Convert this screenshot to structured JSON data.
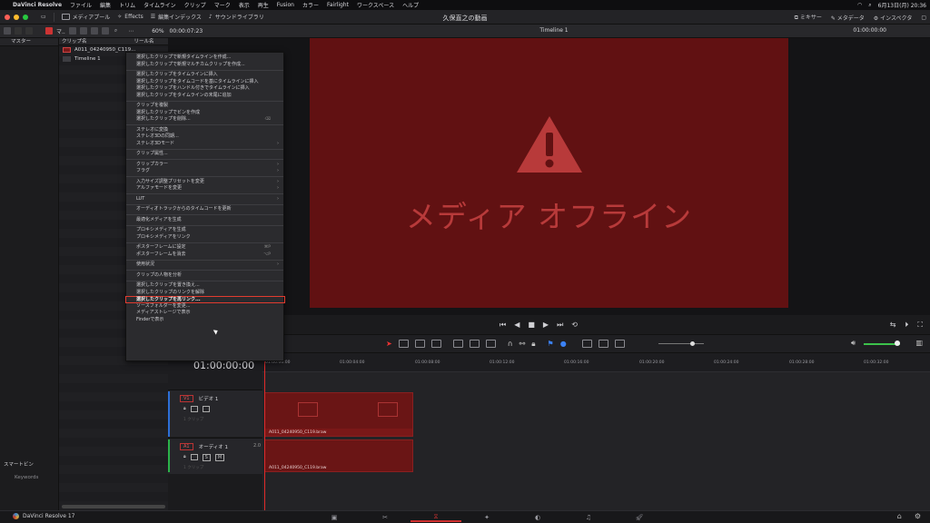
{
  "menubar": {
    "app": "DaVinci Resolve",
    "items": [
      "ファイル",
      "編集",
      "トリム",
      "タイムライン",
      "クリップ",
      "マーク",
      "表示",
      "再生",
      "Fusion",
      "カラー",
      "Fairlight",
      "ワークスペース",
      "ヘルプ"
    ],
    "clock": "6月13日(月)  20:36"
  },
  "topbar": {
    "media_pool": "メディアプール",
    "effects": "Effects",
    "edit_index": "編集インデックス",
    "sound_library": "サウンドライブラリ",
    "project_title": "久保直之の動画",
    "mixer": "ミキサー",
    "metadata": "メタデータ",
    "inspector": "インスペクタ"
  },
  "secbar": {
    "bin_label": "マ..",
    "zoom": "60%",
    "timecode": "00:00:07:23",
    "viewer_title": "Timeline 1",
    "viewer_tc": "01:00:00:00"
  },
  "sidebar": {
    "master": "マスター",
    "smart_bins": "スマートビン",
    "keywords": "Keywords"
  },
  "clip_list": {
    "header": "クリップ名",
    "header2": "リール名",
    "clips": [
      "A011_04240950_C119...",
      "Timeline 1"
    ]
  },
  "viewer": {
    "offline_text": "メディア オフライン"
  },
  "context_menu": {
    "groups": [
      [
        "選択したクリップで新規タイムラインを作成...",
        "選択したクリップで新規マルチカムクリップを作成..."
      ],
      [
        "選択したクリップをタイムラインに挿入",
        "選択したクリップをタイムコードを基にタイムラインに挿入",
        "選択したクリップをハンドル付きでタイムラインに挿入",
        "選択したクリップをタイムラインの末尾に追加"
      ],
      [
        "クリップを複製",
        "選択したクリップでビンを作成",
        "選択したクリップを削除..."
      ],
      [
        "ステレオに変換",
        "ステレオ3Dの同期...",
        "ステレオ3Dモード"
      ],
      [
        "クリップ属性..."
      ],
      [
        "クリップカラー",
        "フラグ"
      ],
      [
        "入力サイズ調整プリセットを変更",
        "アルファモードを変更"
      ],
      [
        "LUT"
      ],
      [
        "オーディオトラックからのタイムコードを更新"
      ],
      [
        "最適化メディアを生成"
      ],
      [
        "プロキシメディアを生成",
        "プロキシメディアをリンク"
      ],
      [
        "ポスターフレームに設定",
        "ポスターフレームを消去"
      ],
      [
        "使用状況"
      ],
      [
        "クリップの人物を分析"
      ],
      [
        "選択したクリップを置き換え...",
        "選択したクリップのリンクを解除",
        "選択したクリップを再リンク...",
        "ソースフォルダーを変更...",
        "メディアストレージで表示",
        "Finderで表示"
      ]
    ],
    "shortcuts": {
      "delete": "⌫",
      "poster_set": "⌘P",
      "poster_clear": "⌥P"
    },
    "highlighted": "選択したクリップを再リンク..."
  },
  "timeline": {
    "timecode": "01:00:00:00",
    "ruler": [
      "01:00:00:00",
      "01:00:04:00",
      "01:00:08:00",
      "01:00:12:00",
      "01:00:16:00",
      "01:00:20:00",
      "01:00:24:00",
      "01:00:28:00",
      "01:00:32:00"
    ],
    "video_track": {
      "tag": "V1",
      "name": "ビデオ 1",
      "count": "1 クリップ"
    },
    "audio_track": {
      "tag": "A1",
      "name": "オーディオ 1",
      "count": "1 クリップ",
      "ch": "2.0"
    },
    "clip_name": "A011_04240950_C119.braw"
  },
  "bottom": {
    "brand": "DaVinci Resolve 17"
  },
  "colors": {
    "accent": "#e02a2a",
    "offline_bg": "#611112",
    "clip_red": "#6a1515"
  }
}
